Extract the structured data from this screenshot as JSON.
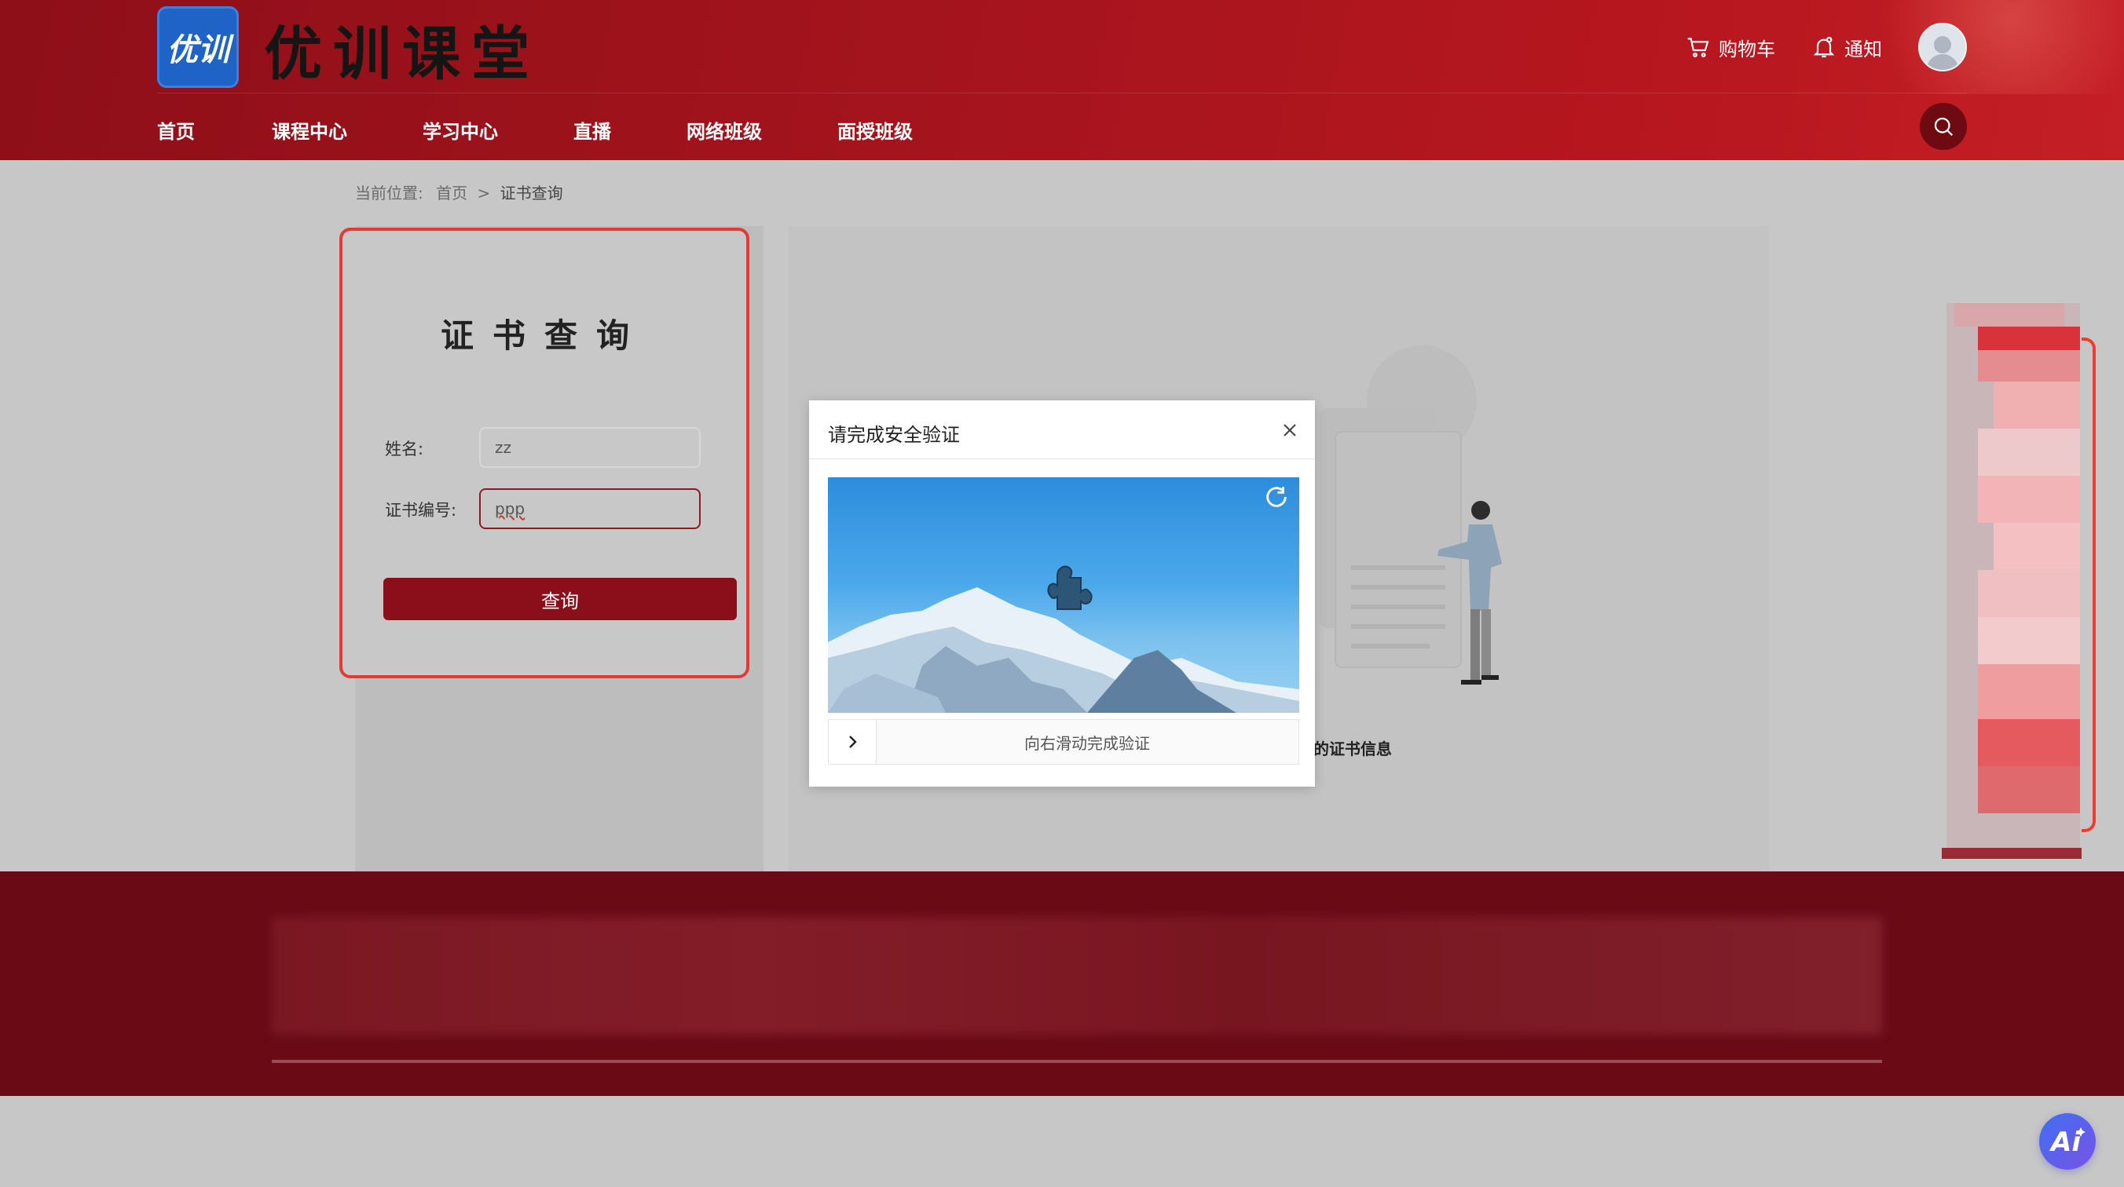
{
  "header": {
    "logo_text": "优训",
    "brand": "优训课堂",
    "cart_label": "购物车",
    "notify_label": "通知",
    "icons": {
      "cart": "cart-icon",
      "bell": "bell-icon",
      "user": "user-avatar",
      "search": "search-icon"
    }
  },
  "nav": {
    "items": [
      {
        "label": "首页"
      },
      {
        "label": "课程中心"
      },
      {
        "label": "学习中心"
      },
      {
        "label": "直播"
      },
      {
        "label": "网络班级"
      },
      {
        "label": "面授班级"
      }
    ]
  },
  "breadcrumb": {
    "prefix": "当前位置:",
    "home": "首页",
    "separator": ">",
    "current": "证书查询"
  },
  "form": {
    "title": "证书查询",
    "name_label": "姓名:",
    "name_value": "zz",
    "cert_label": "证书编号:",
    "cert_value": "ppp",
    "submit_label": "查询"
  },
  "result": {
    "hint_fragment": "的证书信息"
  },
  "captcha": {
    "title": "请完成安全验证",
    "slider_text": "向右滑动完成验证"
  },
  "colors": {
    "brand_red": "#8a0f1a",
    "header_red": "#a5141d",
    "footer_red": "#6a0a15",
    "highlight_border": "#e53935",
    "logo_blue": "#1f63c6"
  }
}
